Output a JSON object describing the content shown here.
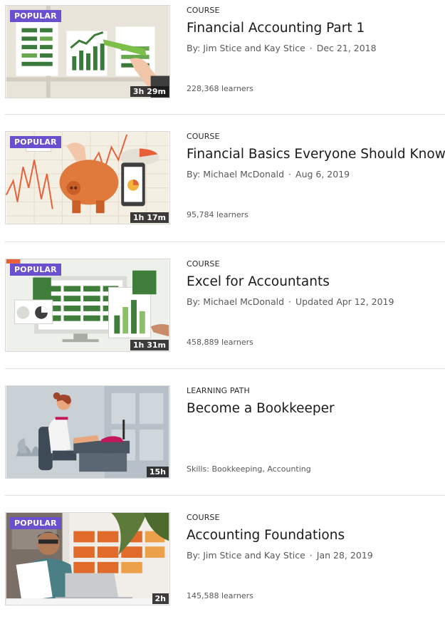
{
  "items": [
    {
      "badge": "POPULAR",
      "duration": "3h 29m",
      "type": "COURSE",
      "title": "Financial Accounting Part 1",
      "author": "By: Jim Stice and Kay Stice",
      "date": "Dec 21, 2018",
      "footer": "228,368 learners"
    },
    {
      "badge": "POPULAR",
      "duration": "1h 17m",
      "type": "COURSE",
      "title": "Financial Basics Everyone Should Know",
      "author": "By: Michael McDonald",
      "date": "Aug 6, 2019",
      "footer": "95,784 learners"
    },
    {
      "badge": "POPULAR",
      "duration": "1h 31m",
      "type": "COURSE",
      "title": "Excel for Accountants",
      "author": "By: Michael McDonald",
      "date": "Updated Apr 12, 2019",
      "footer": "458,889 learners"
    },
    {
      "badge": "",
      "duration": "15h",
      "type": "LEARNING PATH",
      "title": "Become a Bookkeeper",
      "author": "",
      "date": "",
      "footer": "Skills: Bookkeeping, Accounting"
    },
    {
      "badge": "POPULAR",
      "duration": "2h",
      "type": "COURSE",
      "title": "Accounting Foundations",
      "author": "By: Jim Stice and Kay Stice",
      "date": "Jan 28, 2019",
      "footer": "145,588 learners"
    }
  ],
  "meta_separator": "·",
  "colors": {
    "popular_badge": "#6a4fcf",
    "divider": "#e0e0e0",
    "meta_text": "#595959"
  }
}
